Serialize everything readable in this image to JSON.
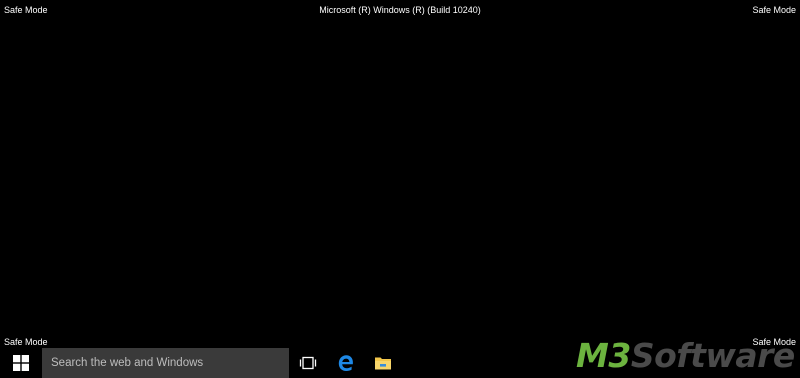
{
  "screen": {
    "safe_mode_label": "Safe Mode",
    "build_label": "Microsoft (R) Windows (R) (Build 10240)"
  },
  "taskbar": {
    "start_icon": "windows-logo-icon",
    "search": {
      "placeholder": "Search the web and Windows"
    },
    "buttons": [
      {
        "icon": "task-view-icon"
      },
      {
        "icon": "edge-browser-icon"
      },
      {
        "icon": "file-explorer-icon"
      }
    ]
  },
  "watermark": {
    "brand_part1": "M3",
    "brand_part2": "Software",
    "colors": {
      "brand_green": "#6cb33f",
      "brand_gray": "#4a4a4a"
    }
  },
  "colors": {
    "desktop_background": "#000000",
    "search_background": "#3a3a3a",
    "accent_blue": "#1e88e5",
    "folder_yellow": "#f3c74b"
  }
}
